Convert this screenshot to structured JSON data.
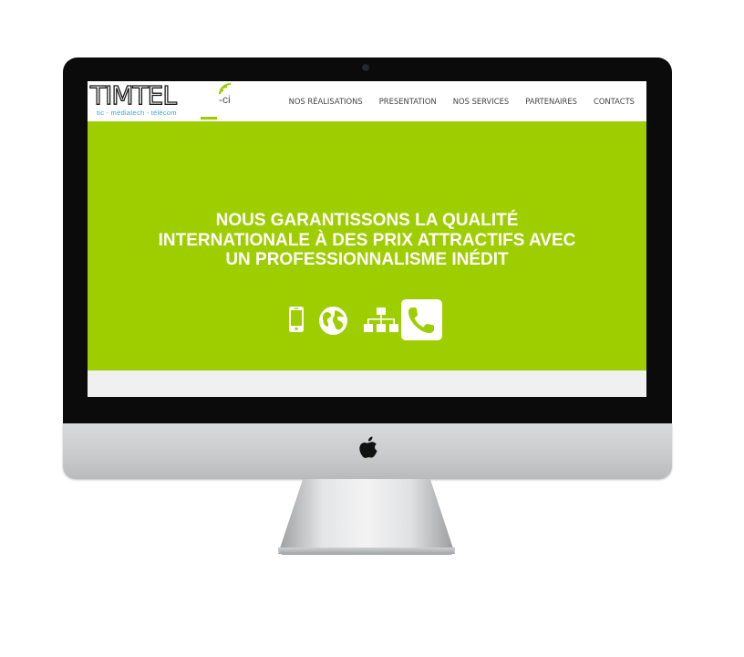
{
  "header": {
    "logo_text": "TIMTEL",
    "logo_suffix": "-ci",
    "logo_tagline": "tic - médiatech - télécom",
    "nav": [
      {
        "label": "NOS RÉALISATIONS"
      },
      {
        "label": "PRESENTATION"
      },
      {
        "label": "NOS SERVICES"
      },
      {
        "label": "PARTENAIRES"
      },
      {
        "label": "CONTACTS"
      }
    ]
  },
  "hero": {
    "title_line1": "NOUS GARANTISSONS LA QUALITÉ",
    "title_line2": "INTERNATIONALE À DES PRIX ATTRACTIFS AVEC",
    "title_line3": "UN PROFESSIONNALISME INÉDIT",
    "background_color": "#9ecd00",
    "icons": [
      "mobile-phone-icon",
      "globe-icon",
      "network-sitemap-icon",
      "phone-handset-icon"
    ]
  },
  "colors": {
    "accent_green": "#9ecd00",
    "tagline_blue": "#3aa6d8"
  }
}
